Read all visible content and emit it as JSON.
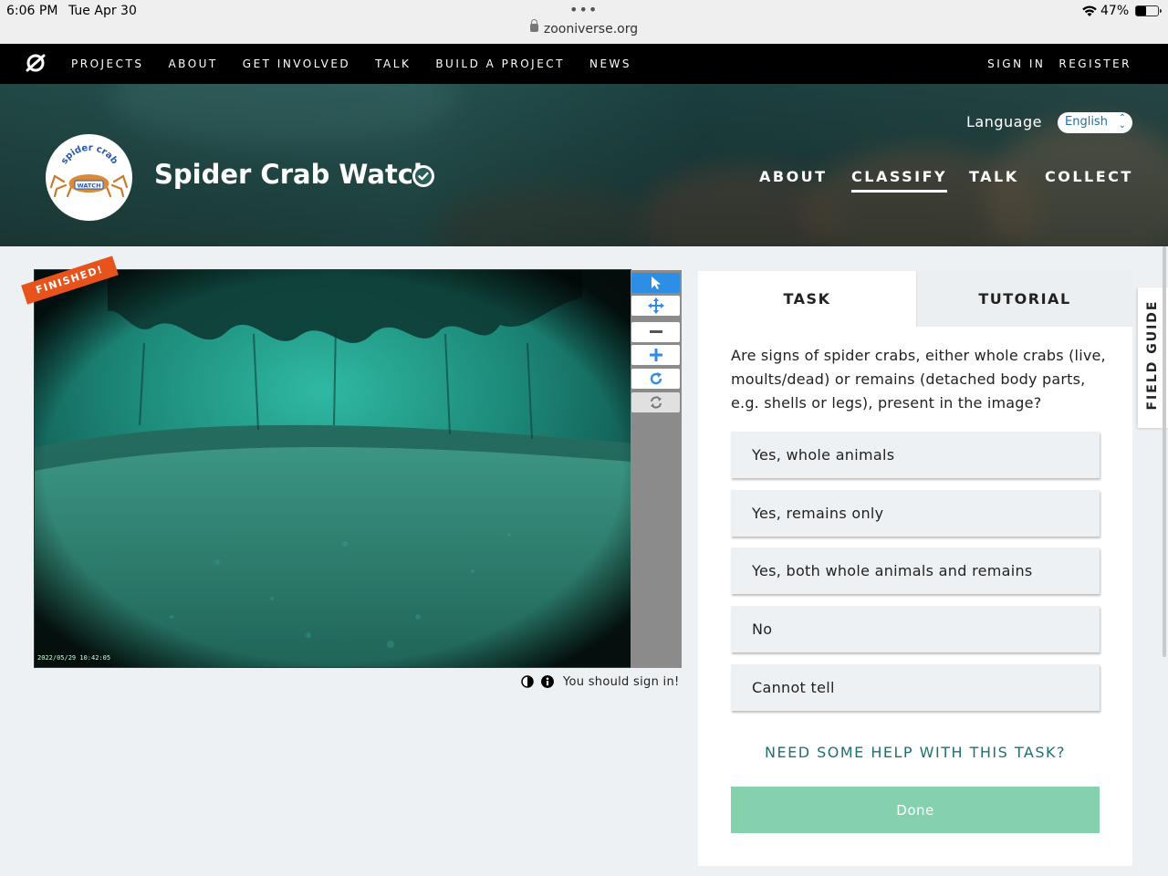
{
  "status_bar": {
    "time": "6:06 PM",
    "date": "Tue Apr 30",
    "url": "zooniverse.org",
    "battery": "47%",
    "battery_level": 0.47
  },
  "top_nav": {
    "items": [
      "PROJECTS",
      "ABOUT",
      "GET INVOLVED",
      "TALK",
      "BUILD A PROJECT",
      "NEWS"
    ],
    "sign_in": "SIGN IN",
    "register": "REGISTER"
  },
  "project": {
    "title": "Spider Crab Watch",
    "logo_top": "spider crab",
    "logo_bottom": "WATCH",
    "language_label": "Language",
    "language_value": "English",
    "tabs": [
      "ABOUT",
      "CLASSIFY",
      "TALK",
      "COLLECT"
    ]
  },
  "subject": {
    "finished": "FINISHED!",
    "timestamp": "2022/05/29 10:42:05",
    "sign_in_notice": "You should sign in!",
    "tools": [
      "pointer-icon",
      "pan-icon",
      "zoom-out-icon",
      "zoom-in-icon",
      "rotate-icon",
      "reset-icon"
    ]
  },
  "task": {
    "tab_task": "TASK",
    "tab_tutorial": "TUTORIAL",
    "question": "Are signs of spider crabs, either whole crabs (live, moults/dead) or remains (detached body parts, e.g. shells or legs), present in the image?",
    "answers": [
      "Yes, whole animals",
      "Yes, remains only",
      "Yes, both whole animals and remains",
      "No",
      "Cannot tell"
    ],
    "help": "NEED SOME HELP WITH THIS TASK?",
    "done": "Done"
  },
  "field_guide": "FIELD GUIDE",
  "colors": {
    "accent_blue": "#2d8ee6",
    "finished_orange": "#e8531c",
    "done_green": "#85d1ae",
    "help_teal": "#1d6f73"
  }
}
